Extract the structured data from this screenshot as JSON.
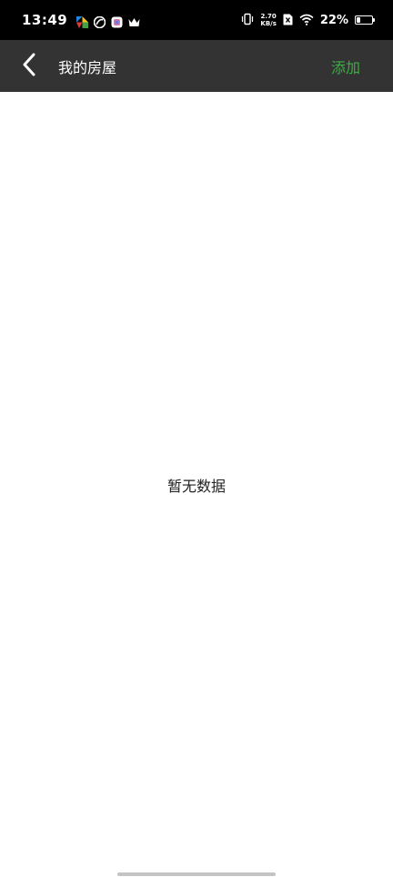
{
  "status_bar": {
    "time": "13:49",
    "net_speed_value": "2.70",
    "net_speed_unit": "KB/s",
    "battery_percent": "22%",
    "battery_level": 0.22,
    "notification_icons": [
      "tangram-icon",
      "swirl-icon",
      "app-badge-icon",
      "crown-icon"
    ]
  },
  "app_bar": {
    "title": "我的房屋",
    "add_label": "添加",
    "accent_color": "#3cb043",
    "background_color": "#333333"
  },
  "content": {
    "empty_message": "暂无数据"
  }
}
